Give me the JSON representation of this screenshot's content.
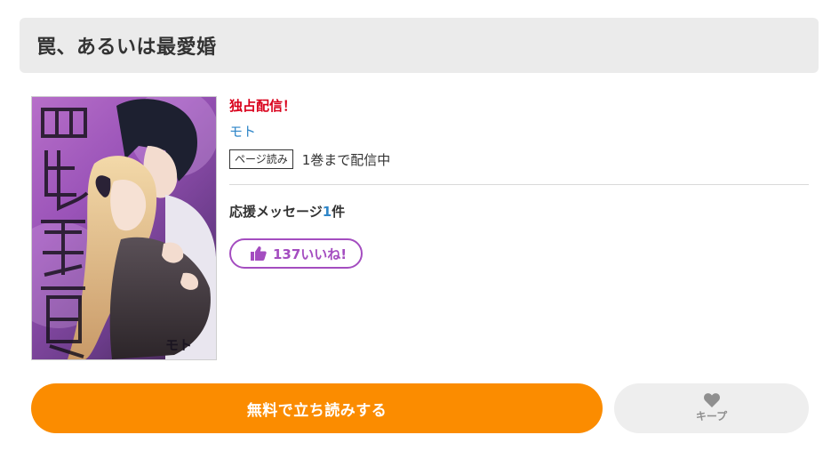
{
  "header": {
    "title": "罠、あるいは最愛婚"
  },
  "book": {
    "cover_title_text": "罠、あるいは最愛婚",
    "cover_author_text": "モト",
    "exclusive_label": "独占配信！",
    "author": "モト",
    "format_badge": "ページ読み",
    "availability": "1巻まで配信中"
  },
  "support": {
    "prefix": "応援メッセージ",
    "count": "1",
    "suffix": "件"
  },
  "like": {
    "label": "137いいね!",
    "icon": "thumbs-up-icon",
    "color": "#a44dc0"
  },
  "actions": {
    "read_label": "無料で立ち読みする",
    "read_color": "#fb8c00",
    "keep_label": "キープ",
    "keep_icon": "heart-icon"
  }
}
